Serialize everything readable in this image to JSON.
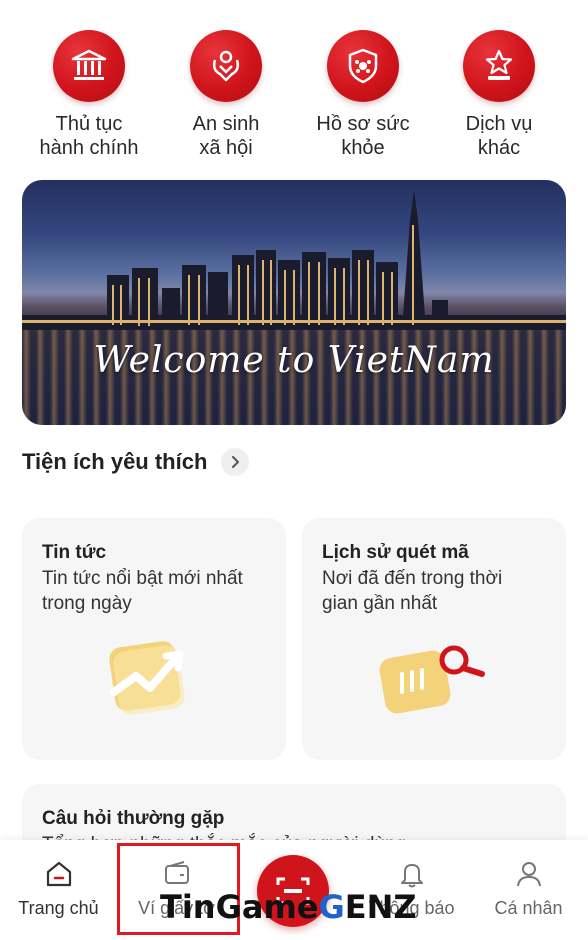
{
  "services": [
    {
      "line1": "Thủ tục",
      "line2": "hành chính",
      "icon": "government-building-icon"
    },
    {
      "line1": "An sinh",
      "line2": "xã hội",
      "icon": "social-welfare-icon"
    },
    {
      "line1": "Hồ sơ sức",
      "line2": "khỏe",
      "icon": "health-shield-icon"
    },
    {
      "line1": "Dịch vụ",
      "line2": "khác",
      "icon": "star-podium-icon"
    }
  ],
  "banner": {
    "text": "Welcome to VietNam"
  },
  "favorites": {
    "title": "Tiện ích yêu thích",
    "cards": [
      {
        "title": "Tin tức",
        "desc_line1": "Tin tức nổi bật mới nhất",
        "desc_line2": "trong ngày"
      },
      {
        "title": "Lịch sử quét mã",
        "desc_line1": "Nơi đã đến trong thời",
        "desc_line2": "gian gần nhất"
      },
      {
        "title": "Câu hỏi thường gặp",
        "desc_line1": "Tổng hợp những thắc mắc của người dùng"
      }
    ]
  },
  "nav": {
    "home": "Trang chủ",
    "wallet": "Ví giấy tờ",
    "notifications": "Thông báo",
    "profile": "Cá nhân"
  },
  "watermark": {
    "part1": "TinGame",
    "part2": "G",
    "part3": "ENZ"
  },
  "colors": {
    "brand_red": "#d0141c",
    "highlight": "#e01a22"
  }
}
